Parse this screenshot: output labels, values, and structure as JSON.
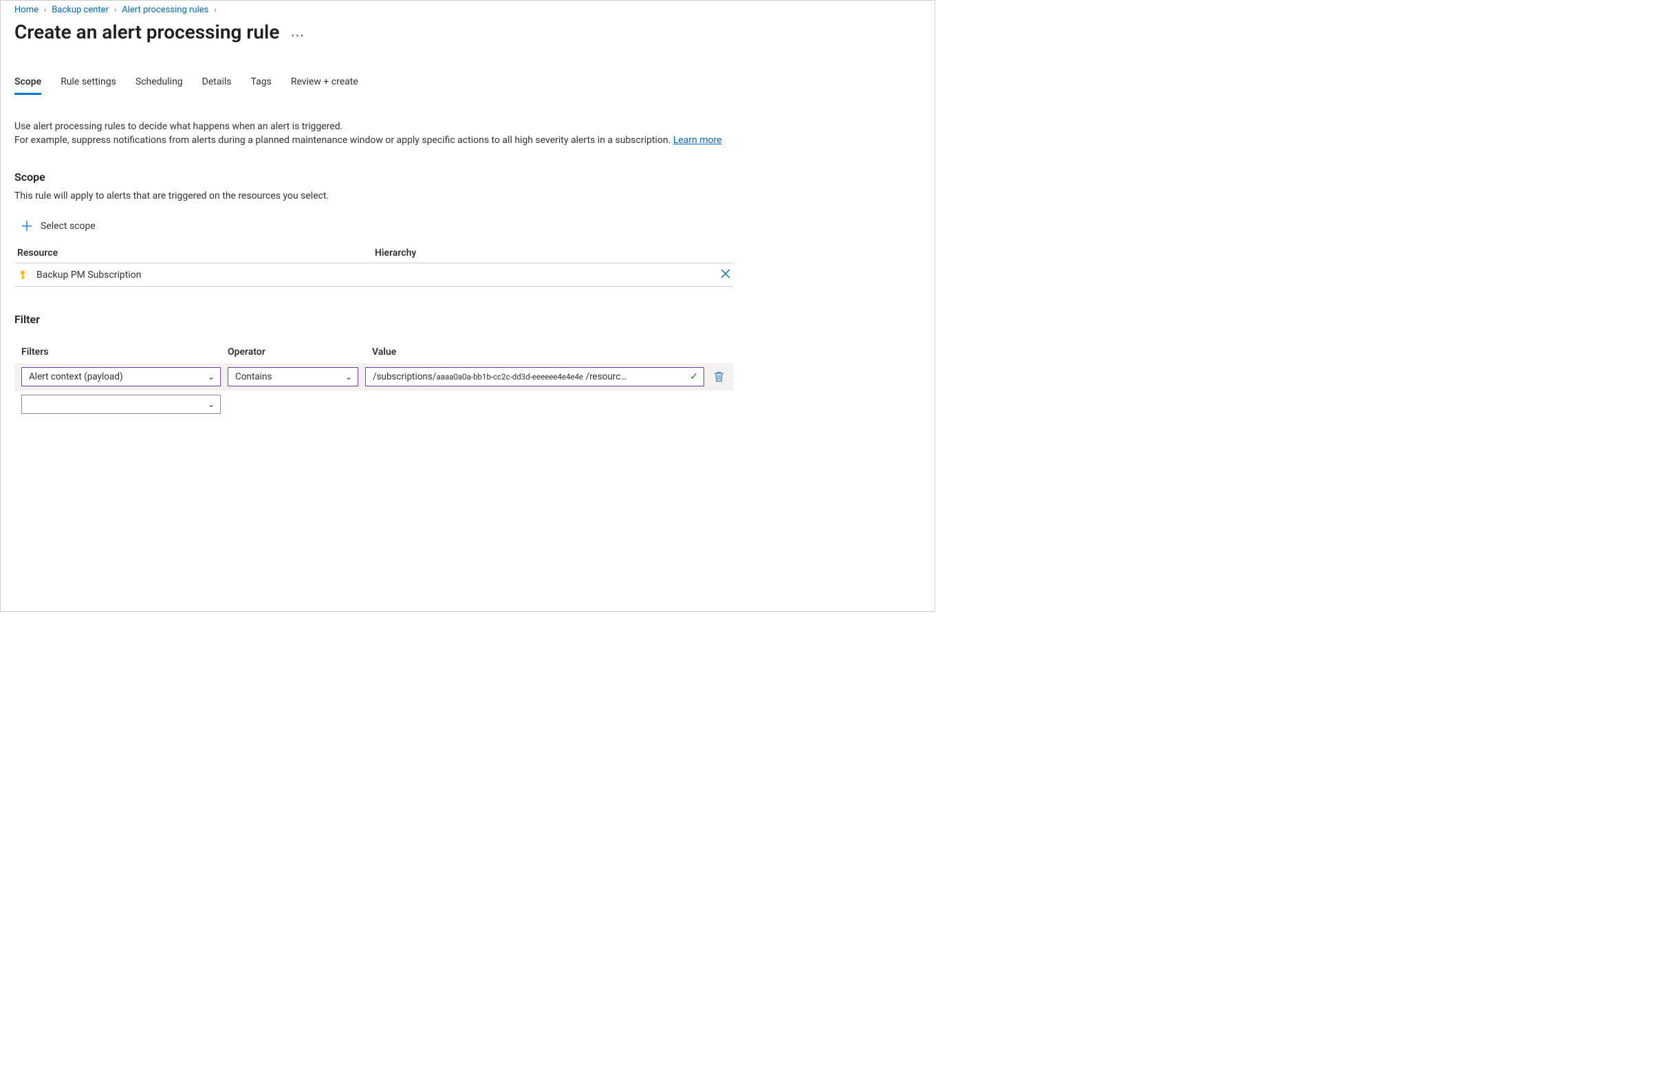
{
  "breadcrumbs": {
    "items": [
      {
        "label": "Home"
      },
      {
        "label": "Backup center"
      },
      {
        "label": "Alert processing rules"
      }
    ]
  },
  "page": {
    "title": "Create an alert processing rule"
  },
  "tabs": {
    "items": [
      {
        "id": "scope",
        "label": "Scope",
        "active": true
      },
      {
        "id": "rule-settings",
        "label": "Rule settings"
      },
      {
        "id": "scheduling",
        "label": "Scheduling"
      },
      {
        "id": "details",
        "label": "Details"
      },
      {
        "id": "tags",
        "label": "Tags"
      },
      {
        "id": "review-create",
        "label": "Review + create"
      }
    ]
  },
  "description": {
    "line1": "Use alert processing rules to decide what happens when an alert is triggered.",
    "line2": "For example, suppress notifications from alerts during a planned maintenance window or apply specific actions to all high severity alerts in a subscription. ",
    "link": "Learn more"
  },
  "scope": {
    "heading": "Scope",
    "sub": "This rule will apply to alerts that are triggered on the resources you select.",
    "select_scope_label": "Select scope",
    "columns": {
      "resource": "Resource",
      "hierarchy": "Hierarchy"
    },
    "rows": [
      {
        "resource": "Backup PM Subscription",
        "hierarchy": ""
      }
    ]
  },
  "filter": {
    "heading": "Filter",
    "columns": {
      "filters": "Filters",
      "operator": "Operator",
      "value": "Value"
    },
    "rows": [
      {
        "filter": "Alert context (payload)",
        "operator": "Contains",
        "value_prefix": "/subscriptions/",
        "value_small": "aaaa0a0a-bb1b-cc2c-dd3d-eeeeee4e4e4e",
        "value_suffix": " /resourc…"
      }
    ]
  }
}
